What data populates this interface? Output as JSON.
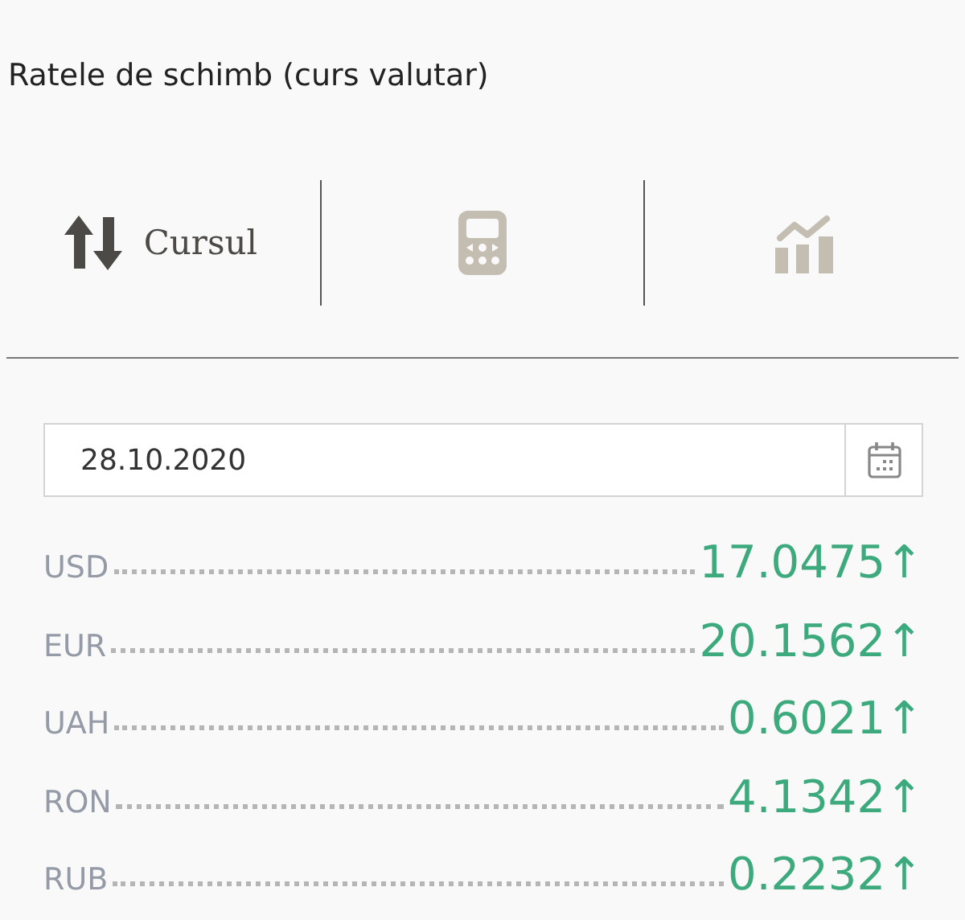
{
  "title": "Ratele de schimb (curs valutar)",
  "tabs": [
    {
      "kind": "rates",
      "label": "Cursul",
      "selected": true
    },
    {
      "kind": "calculator",
      "selected": false
    },
    {
      "kind": "chart",
      "selected": false
    }
  ],
  "date_field": {
    "value": "28.10.2020"
  },
  "rates": [
    {
      "code": "USD",
      "value": "17.0475",
      "arrow": "↑"
    },
    {
      "code": "EUR",
      "value": "20.1562",
      "arrow": "↑"
    },
    {
      "code": "UAH",
      "value": "0.6021",
      "arrow": "↑"
    },
    {
      "code": "RON",
      "value": "4.1342",
      "arrow": "↑"
    },
    {
      "code": "RUB",
      "value": "0.2232",
      "arrow": "↑"
    }
  ]
}
